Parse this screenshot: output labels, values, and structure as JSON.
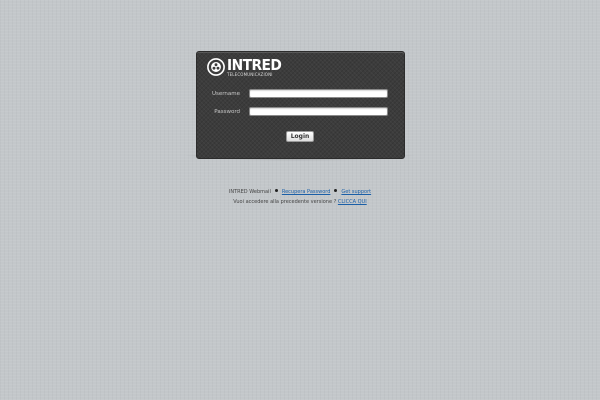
{
  "brand": {
    "name": "INTRED",
    "subtitle": "TELECOMUNICAZIONI"
  },
  "form": {
    "username_label": "Username",
    "username_value": "",
    "password_label": "Password",
    "password_value": "",
    "login_label": "Login"
  },
  "footer": {
    "webmail_label": "INTRED Webmail",
    "recover_password": "Recupera Password",
    "get_support": "Get support",
    "old_version_text": "Vuoi accedere alla precedente versione ?",
    "old_version_link": "CLICCA QUI"
  },
  "colors": {
    "page_background": "#c3c7ca",
    "panel_background": "#3c3c3c",
    "link": "#1a5fa8"
  },
  "icons": {
    "logo": "intred-logo-icon",
    "separator": "bullet-icon"
  }
}
